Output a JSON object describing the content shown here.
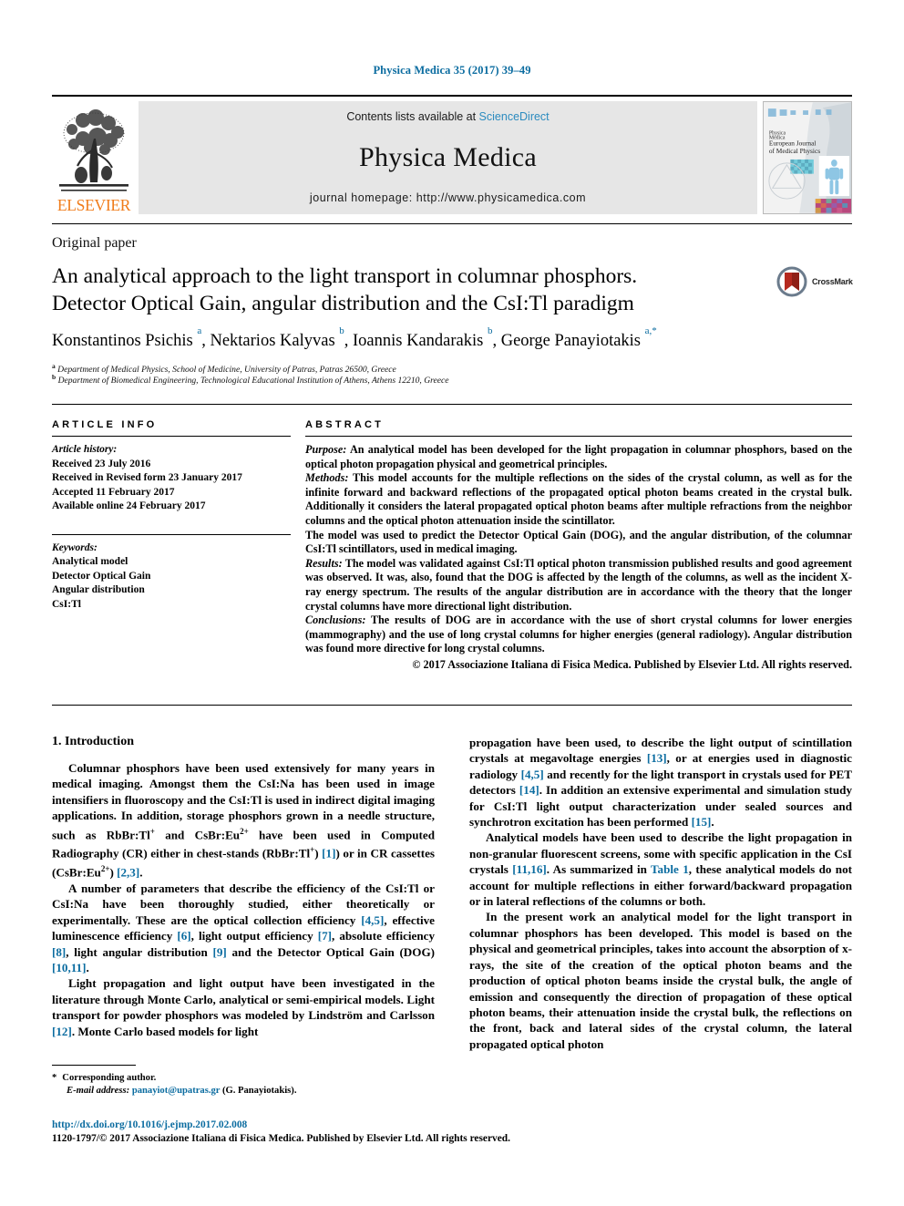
{
  "running_head": "Physica Medica 35 (2017) 39–49",
  "banner": {
    "publisher_logo_text": "ELSEVIER",
    "contents_prefix": "Contents lists available at ",
    "contents_link": "ScienceDirect",
    "journal_name": "Physica Medica",
    "homepage": "journal homepage: http://www.physicamedica.com",
    "cover": {
      "line1": "Physica",
      "line2": "Medica",
      "line3": "European Journal",
      "line4": "of Medical Physics"
    }
  },
  "article": {
    "kicker": "Original paper",
    "title_line1": "An analytical approach to the light transport in columnar phosphors.",
    "title_line2": "Detector Optical Gain, angular distribution and the CsI:Tl paradigm",
    "crossmark_label": "CrossMark",
    "authors": "Konstantinos Psichis a, Nektarios Kalyvas b, Ioannis Kandarakis b, George Panayiotakis a,*",
    "affiliation_a": "Department of Medical Physics, School of Medicine, University of Patras, Patras 26500, Greece",
    "affiliation_b": "Department of Biomedical Engineering, Technological Educational Institution of Athens, Athens 12210, Greece"
  },
  "info": {
    "heading": "ARTICLE INFO",
    "history_title": "Article history:",
    "history": [
      "Received 23 July 2016",
      "Received in Revised form 23 January 2017",
      "Accepted 11 February 2017",
      "Available online 24 February 2017"
    ],
    "keywords_title": "Keywords:",
    "keywords": [
      "Analytical model",
      "Detector Optical Gain",
      "Angular distribution",
      "CsI:Tl"
    ]
  },
  "abstract": {
    "heading": "ABSTRACT",
    "purpose_label": "Purpose:",
    "purpose_text": " An analytical model has been developed for the light propagation in columnar phosphors, based on the optical photon propagation physical and geometrical principles.",
    "methods_label": "Methods:",
    "methods_text": " This model accounts for the multiple reflections on the sides of the crystal column, as well as for the infinite forward and backward reflections of the propagated optical photon beams created in the crystal bulk. Additionally it considers the lateral propagated optical photon beams after multiple refractions from the neighbor columns and the optical photon attenuation inside the scintillator.",
    "model_text": "The model was used to predict the Detector Optical Gain (DOG), and the angular distribution, of the columnar CsI:Tl scintillators, used in medical imaging.",
    "results_label": "Results:",
    "results_text": " The model was validated against CsI:Tl optical photon transmission published results and good agreement was observed. It was, also, found that the DOG is affected by the length of the columns, as well as the incident X-ray energy spectrum. The results of the angular distribution are in accordance with the theory that the longer crystal columns have more directional light distribution.",
    "conclusions_label": "Conclusions:",
    "conclusions_text": " The results of DOG are in accordance with the use of short crystal columns for lower energies (mammography) and the use of long crystal columns for higher energies (general radiology). Angular distribution was found more directive for long crystal columns.",
    "copyright": "© 2017 Associazione Italiana di Fisica Medica. Published by Elsevier Ltd. All rights reserved."
  },
  "body": {
    "section_heading": "1. Introduction",
    "left": {
      "p1_a": "Columnar phosphors have been used extensively for many years in medical imaging. Amongst them the CsI:Na has been used in image intensifiers in fluoroscopy and the CsI:Tl is used in indirect digital imaging applications. In addition, storage phosphors grown in a needle structure, such as RbBr:Tl",
      "p1_b": " and CsBr:Eu",
      "p1_c": " have been used in Computed Radiography (CR) either in chest-stands (RbBr:Tl",
      "p1_ref1": "[1]",
      "p1_d": ") or in CR cassettes (CsBr:Eu",
      "p1_ref2": "[2,3]",
      "p1_e": ").",
      "p2_a": "A number of parameters that describe the efficiency of the CsI:Tl or CsI:Na have been thoroughly studied, either theoretically or experimentally. These are the optical collection efficiency ",
      "p2_ref1": "[4,5]",
      "p2_b": ", effective luminescence efficiency ",
      "p2_ref2": "[6]",
      "p2_c": ", light output efficiency ",
      "p2_ref3": "[7]",
      "p2_d": ", absolute efficiency ",
      "p2_ref4": "[8]",
      "p2_e": ", light angular distribution ",
      "p2_ref5": "[9]",
      "p2_f": " and the Detector Optical Gain (DOG) ",
      "p2_ref6": "[10,11]",
      "p2_g": ".",
      "p3_a": "Light propagation and light output have been investigated in the literature through Monte Carlo, analytical or semi-empirical models. Light transport for powder phosphors was modeled by Lindström and Carlsson ",
      "p3_ref1": "[12]",
      "p3_b": ". Monte Carlo based models for light"
    },
    "right": {
      "p1_a": "propagation have been used, to describe the light output of scintillation crystals at megavoltage energies ",
      "p1_ref1": "[13]",
      "p1_b": ", or at energies used in diagnostic radiology ",
      "p1_ref2": "[4,5]",
      "p1_c": " and recently for the light transport in crystals used for PET detectors ",
      "p1_ref3": "[14]",
      "p1_d": ". In addition an extensive experimental and simulation study for CsI:Tl light output characterization under sealed sources and synchrotron excitation has been performed ",
      "p1_ref4": "[15]",
      "p1_e": ".",
      "p2_a": "Analytical models have been used to describe the light propagation in non-granular fluorescent screens, some with specific application in the CsI crystals ",
      "p2_ref1": "[11,16]",
      "p2_b": ". As summarized in ",
      "p2_ref2": "Table 1",
      "p2_c": ", these analytical models do not account for multiple reflections in either forward/backward propagation or in lateral reflections of the columns or both.",
      "p3": "In the present work an analytical model for the light transport in columnar phosphors has been developed. This model is based on the physical and geometrical principles, takes into account the absorption of x-rays, the site of the creation of the optical photon beams and the production of optical photon beams inside the crystal bulk, the angle of emission and consequently the direction of propagation of these optical photon beams, their attenuation inside the crystal bulk, the reflections on the front, back and lateral sides of the crystal column, the lateral propagated optical photon"
    }
  },
  "footnote": {
    "star": "*",
    "corresponding": "Corresponding author.",
    "email_label": "E-mail address:",
    "email": "panayiot@upatras.gr",
    "email_owner": "(G. Panayiotakis)."
  },
  "footer": {
    "doi": "http://dx.doi.org/10.1016/j.ejmp.2017.02.008",
    "issn_line": "1120-1797/© 2017 Associazione Italiana di Fisica Medica. Published by Elsevier Ltd. All rights reserved."
  },
  "colors": {
    "link": "#0b6ca0",
    "science_direct": "#2b8bbf",
    "elsevier_orange": "#f07c1a",
    "banner_bg": "#e6e6e6"
  }
}
